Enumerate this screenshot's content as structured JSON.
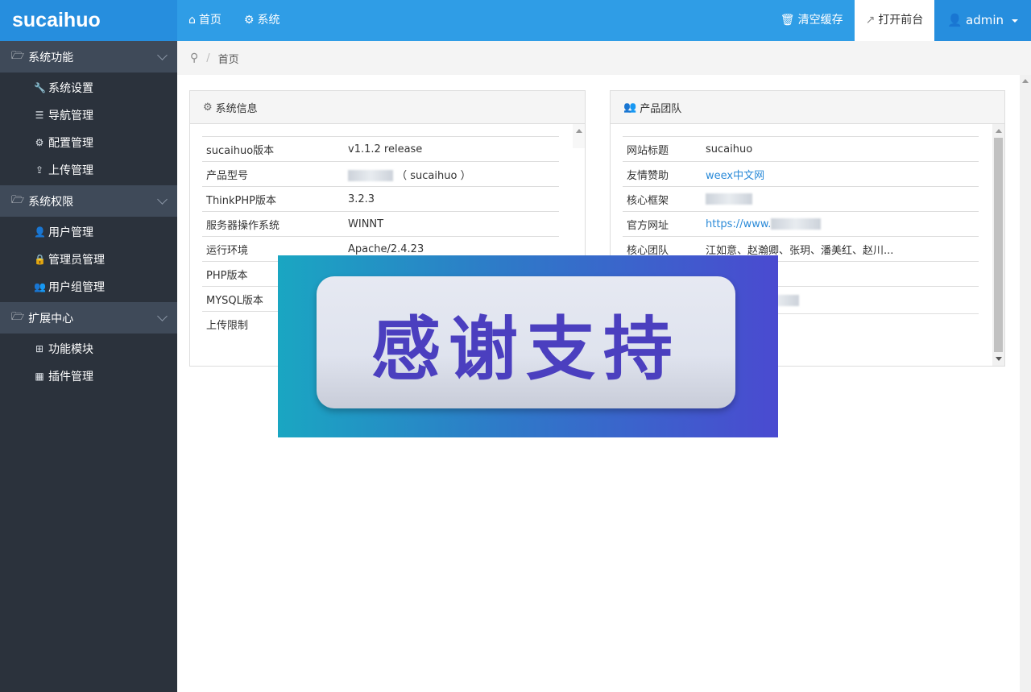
{
  "brand": "sucaihuo",
  "topnav": [
    {
      "label": "首页",
      "icon": "home-icon"
    },
    {
      "label": "系统",
      "icon": "gear-icon"
    }
  ],
  "topright": {
    "clear_cache": "清空缓存",
    "open_front": "打开前台",
    "user": "admin"
  },
  "sidebar": {
    "groups": [
      {
        "label": "系统功能",
        "items": [
          "系统设置",
          "导航管理",
          "配置管理",
          "上传管理"
        ]
      },
      {
        "label": "系统权限",
        "items": [
          "用户管理",
          "管理员管理",
          "用户组管理"
        ]
      },
      {
        "label": "扩展中心",
        "items": [
          "功能模块",
          "插件管理"
        ]
      }
    ]
  },
  "breadcrumb": {
    "current": "首页"
  },
  "sysinfo": {
    "title": "系统信息",
    "rows": [
      {
        "key": "sucaihuo版本",
        "value": "v1.1.2 release"
      },
      {
        "key": "产品型号",
        "value": "（ sucaihuo ）"
      },
      {
        "key": "ThinkPHP版本",
        "value": "3.2.3"
      },
      {
        "key": "服务器操作系统",
        "value": "WINNT"
      },
      {
        "key": "运行环境",
        "value": "Apache/2.4.23"
      },
      {
        "key": "PHP版本",
        "value": ""
      },
      {
        "key": "MYSQL版本",
        "value": ""
      },
      {
        "key": "上传限制",
        "value": ""
      }
    ]
  },
  "team": {
    "title": "产品团队",
    "rows": [
      {
        "key": "网站标题",
        "value": "sucaihuo"
      },
      {
        "key": "友情赞助",
        "value": "weex中文网"
      },
      {
        "key": "核心框架",
        "value": ""
      },
      {
        "key": "官方网址",
        "value": "https://www."
      },
      {
        "key": "核心团队",
        "value": "江如意、赵瀚卿、张玥、潘美红、赵川..."
      },
      {
        "key": "",
        "value": ""
      },
      {
        "key": "",
        "value": ""
      }
    ]
  },
  "banner": {
    "text": "感谢支持"
  },
  "colors": {
    "topbar": "#2f9de6",
    "brand_bg": "#268ede",
    "sidebar": "#2b323c",
    "sidebar_group": "#3f4a59",
    "link": "#2a8ad8",
    "banner_text": "#4b3fbf"
  }
}
